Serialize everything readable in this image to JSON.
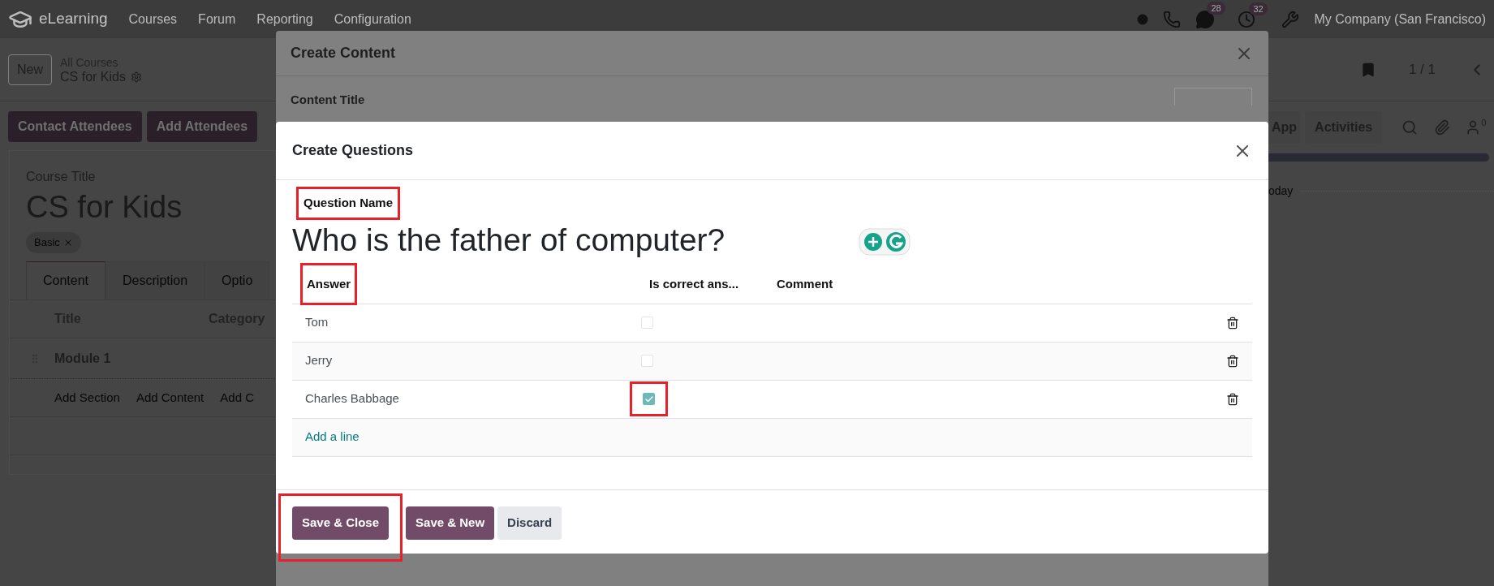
{
  "navbar": {
    "app": "eLearning",
    "menu": [
      "Courses",
      "Forum",
      "Reporting",
      "Configuration"
    ],
    "chat_count": "28",
    "activity_count": "32",
    "company": "My Company (San Francisco)"
  },
  "control_panel": {
    "new_button": "New",
    "breadcrumb_parent": "All Courses",
    "breadcrumb_current": "CS for Kids",
    "pager": "1 / 1"
  },
  "actions": [
    "Contact Attendees",
    "Add Attendees"
  ],
  "course": {
    "title_label": "Course Title",
    "title": "CS for Kids",
    "tags": [
      "Basic"
    ],
    "tabs": [
      {
        "label": "Content",
        "selected": true
      },
      {
        "label": "Description",
        "selected": false
      },
      {
        "label": "Optio",
        "selected": false
      }
    ],
    "columns": [
      "Title",
      "Category"
    ],
    "section": "Module 1",
    "add_links": [
      "Add Section",
      "Add Content",
      "Add C"
    ]
  },
  "chatter": {
    "buttons": [
      "App",
      "Activities"
    ],
    "follower_count": "0",
    "date_separator": "oday"
  },
  "content_dialog": {
    "title": "Create Content",
    "field_label": "Content Title"
  },
  "question_dialog": {
    "title": "Create Questions",
    "question_label": {
      "text": "Question Name",
      "highlighted": true
    },
    "question": "Who is the father of computer?",
    "columns": [
      {
        "label": "Answer",
        "highlighted": true
      },
      {
        "label": "Is correct ans...",
        "highlighted": false
      },
      {
        "label": "Comment",
        "highlighted": false
      }
    ],
    "rows": [
      {
        "answer": "Tom",
        "correct": false,
        "highlighted": false
      },
      {
        "answer": "Jerry",
        "correct": false,
        "highlighted": false
      },
      {
        "answer": "Charles Babbage",
        "correct": true,
        "highlighted": true
      }
    ],
    "add_line": "Add a line",
    "buttons": [
      {
        "label": "Save & Close",
        "kind": "primary",
        "highlighted": true
      },
      {
        "label": "Save & New",
        "kind": "primary",
        "highlighted": false
      },
      {
        "label": "Discard",
        "kind": "secondary",
        "highlighted": false
      }
    ]
  }
}
